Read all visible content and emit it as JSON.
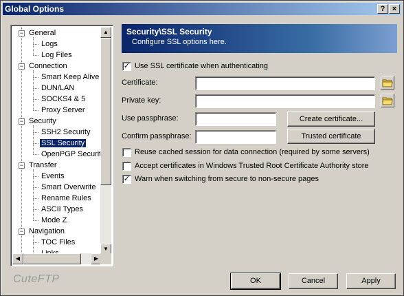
{
  "window": {
    "title": "Global Options",
    "help_glyph": "?",
    "close_glyph": "×"
  },
  "tree": {
    "items": [
      {
        "label": "General",
        "level": 0,
        "expanded": true
      },
      {
        "label": "Logs",
        "level": 1
      },
      {
        "label": "Log Files",
        "level": 1
      },
      {
        "label": "Connection",
        "level": 0,
        "expanded": true
      },
      {
        "label": "Smart Keep Alive",
        "level": 1
      },
      {
        "label": "DUN/LAN",
        "level": 1
      },
      {
        "label": "SOCKS4 & 5",
        "level": 1
      },
      {
        "label": "Proxy Server",
        "level": 1
      },
      {
        "label": "Security",
        "level": 0,
        "expanded": true
      },
      {
        "label": "SSH2 Security",
        "level": 1
      },
      {
        "label": "SSL Security",
        "level": 1,
        "selected": true
      },
      {
        "label": "OpenPGP Security",
        "level": 1
      },
      {
        "label": "Transfer",
        "level": 0,
        "expanded": true
      },
      {
        "label": "Events",
        "level": 1
      },
      {
        "label": "Smart Overwrite",
        "level": 1
      },
      {
        "label": "Rename Rules",
        "level": 1
      },
      {
        "label": "ASCII Types",
        "level": 1
      },
      {
        "label": "Mode Z",
        "level": 1
      },
      {
        "label": "Navigation",
        "level": 0,
        "expanded": true
      },
      {
        "label": "TOC Files",
        "level": 1
      },
      {
        "label": "Links",
        "level": 1
      }
    ],
    "expander_glyph": "−",
    "scroll_up_glyph": "▲",
    "scroll_down_glyph": "▼",
    "scroll_left_glyph": "◀",
    "scroll_right_glyph": "▶"
  },
  "brand": "CuteFTP",
  "panel": {
    "title": "Security\\SSL Security",
    "subtitle": "Configure SSL options here.",
    "use_ssl_cert_label": "Use SSL certificate when authenticating",
    "use_ssl_cert_checked": true,
    "certificate_label": "Certificate:",
    "certificate_value": "",
    "private_key_label": "Private key:",
    "private_key_value": "",
    "use_passphrase_label": "Use passphrase:",
    "use_passphrase_value": "",
    "confirm_passphrase_label": "Confirm passphrase:",
    "confirm_passphrase_value": "",
    "create_certificate_button": "Create certificate...",
    "trusted_certificate_button": "Trusted certificate",
    "reuse_session_label": "Reuse cached session for data connection (required by some servers)",
    "reuse_session_checked": false,
    "accept_windows_label": "Accept certificates in Windows Trusted Root Certificate Authority store",
    "accept_windows_checked": false,
    "warn_switch_label": "Warn when switching from secure to non-secure pages",
    "warn_switch_checked": true,
    "check_glyph": "✓"
  },
  "footer": {
    "ok": "OK",
    "cancel": "Cancel",
    "apply": "Apply"
  },
  "colors": {
    "title_bar": "#0a246a",
    "selection": "#0a246a",
    "dialog_bg": "#d4d0c8"
  }
}
